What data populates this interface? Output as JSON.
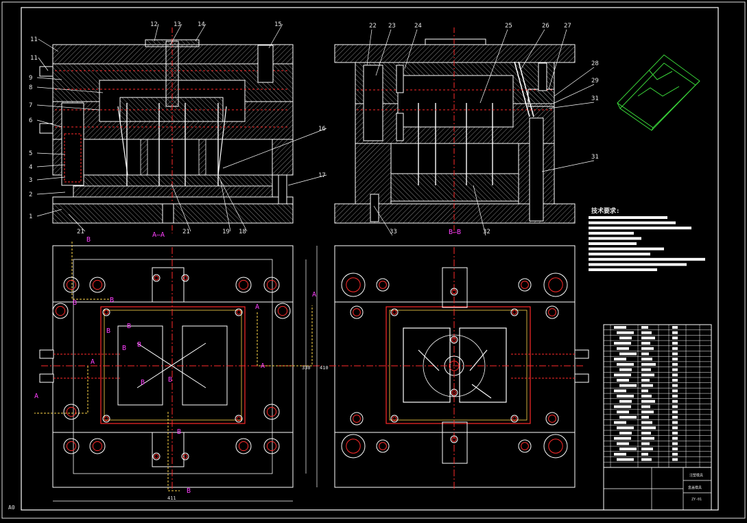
{
  "drawing": {
    "sheet_size": "A0",
    "background": "#000000",
    "colors": {
      "outline": "#ffffff",
      "hatch": "#8a8a8a",
      "red": "#ff2a2a",
      "magenta": "#ff40ff",
      "yellow": "#ffd84a",
      "green": "#3ad63a"
    }
  },
  "views": {
    "left_section_label": "A—A",
    "right_section_label": "B—B",
    "left_part_numbers": [
      "11",
      "11",
      "9",
      "8",
      "7",
      "6",
      "5",
      "4",
      "3",
      "2",
      "1",
      "12",
      "13",
      "14",
      "15",
      "16",
      "17",
      "21",
      "21",
      "19",
      "18"
    ],
    "right_part_numbers": [
      "22",
      "23",
      "24",
      "25",
      "26",
      "27",
      "28",
      "29",
      "31",
      "31",
      "33",
      "32"
    ]
  },
  "plan_views": {
    "markers_left": [
      "B",
      "B",
      "B",
      "A",
      "A",
      "A",
      "A",
      "A",
      "B",
      "B",
      "B",
      "B",
      "B",
      "B",
      "B",
      "B"
    ],
    "dim_bottom": "411",
    "dim_right_outer": "410",
    "dim_right_inner": "330"
  },
  "tech_requirements": {
    "title": "技术要求:"
  },
  "title_block": {
    "project": "注塑模具",
    "drawing_name": "盒盖模具",
    "drawing_no": "ZY-01"
  }
}
